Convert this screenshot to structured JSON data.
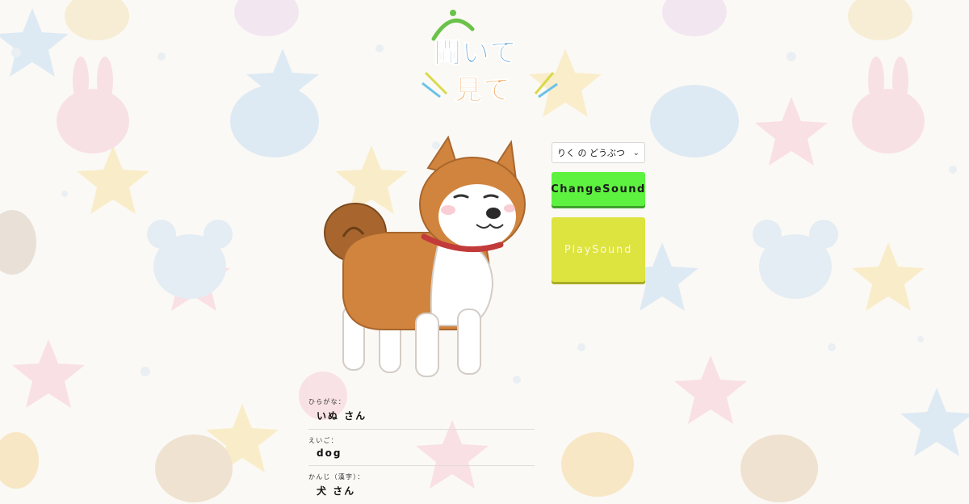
{
  "logo": {
    "line1": "聞いて",
    "line2": "見て"
  },
  "category_select": {
    "selected": "りく の どうぶつ"
  },
  "buttons": {
    "change_sound": "ChangeSound",
    "play_sound": "PlaySound"
  },
  "animal": {
    "icon": "shiba-dog-illustration",
    "hiragana_label": "ひらがな：",
    "hiragana_value": "いぬ さん",
    "english_label": "えいご：",
    "english_value": "dog",
    "kanji_label": "かんじ（漢字）：",
    "kanji_value": "犬 さん"
  },
  "colors": {
    "change_button": "#5df23f",
    "play_button": "#dde33f",
    "background": "#fbf9f5"
  }
}
